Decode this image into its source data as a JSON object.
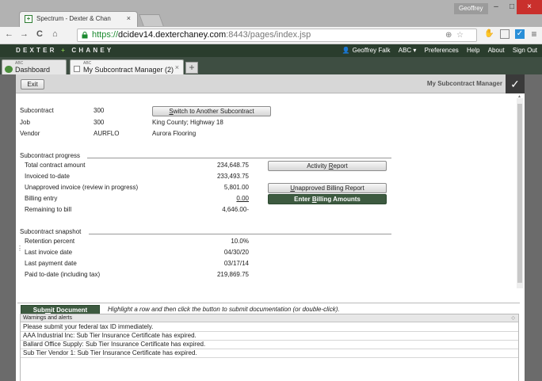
{
  "browser": {
    "tab_title": "Spectrum - Dexter & Chan",
    "tab_close": "×",
    "favicon": "+",
    "user": "Geoffrey",
    "window_controls": {
      "minimize": "–",
      "maximize": "□",
      "close": "×"
    },
    "url_scheme": "https://",
    "url_host": "dcidev14.dexterchaney.com",
    "url_path": ":8443/pages/index.jsp",
    "nav_icons": {
      "back": "←",
      "forward": "→",
      "reload": "C",
      "home": "⌂"
    },
    "omnibox_icons": {
      "zoom": "⊕",
      "star": "☆"
    }
  },
  "app_header": {
    "brand_left": "DEXTER",
    "brand_plus": "+",
    "brand_right": "CHANEY",
    "user_name": "Geoffrey Falk",
    "company": "ABC ▾",
    "links": [
      "Preferences",
      "Help",
      "About",
      "Sign Out"
    ]
  },
  "app_tabs": [
    {
      "small": "ABC",
      "label": "Dashboard"
    },
    {
      "small": "ABC",
      "label": "My Subcontract Manager (2)",
      "close": "×"
    }
  ],
  "add_tab": "+",
  "toolbar": {
    "exit_label": "Exit",
    "title": "My Subcontract Manager",
    "confirm": "✓"
  },
  "header_info": {
    "subcontract_label": "Subcontract",
    "subcontract_value": "300",
    "job_label": "Job",
    "job_value": "300",
    "job_desc": "King County; Highway 18",
    "vendor_label": "Vendor",
    "vendor_value": "AURFLO",
    "vendor_desc": "Aurora Flooring",
    "switch_button": "Switch to Another Subcontract"
  },
  "progress": {
    "title": "Subcontract progress",
    "rows": [
      {
        "label": "Total contract amount",
        "value": "234,648.75"
      },
      {
        "label": "Invoiced to-date",
        "value": "233,493.75"
      },
      {
        "label": "Unapproved invoice (review in progress)",
        "value": "5,801.00"
      },
      {
        "label": "Billing entry",
        "value": "0.00"
      },
      {
        "label": "Remaining to bill",
        "value": "4,646.00-"
      }
    ],
    "activity_button": "Activity Report",
    "unapproved_button": "Unapproved Billing Report",
    "enter_button": "Enter Billing Amounts"
  },
  "snapshot": {
    "title": "Subcontract snapshot",
    "rows": [
      {
        "label": "Retention percent",
        "value": "10.0%"
      },
      {
        "label": "Last invoice date",
        "value": "04/30/20"
      },
      {
        "label": "Last payment date",
        "value": "03/17/14"
      },
      {
        "label": "Paid to-date (including tax)",
        "value": "219,869.75"
      }
    ]
  },
  "submit": {
    "button": "Submit Document",
    "hint": "Highlight a row and then click the button to submit documentation (or double-click)."
  },
  "warnings": {
    "header": "Warnings and alerts",
    "rows": [
      "Please submit your federal tax ID immediately.",
      "AAA Industrial Inc: Sub Tier Insurance Certificate has expired.",
      "Ballard Office Supply: Sub Tier Insurance Certificate has expired.",
      "Sub Tier Vendor 1: Sub Tier Insurance Certificate has expired."
    ]
  },
  "colors": {
    "brand_dark": "#2a3d2d",
    "button_green": "#3d5a40",
    "https_green": "#1b8a2f",
    "close_red": "#c9302c"
  }
}
